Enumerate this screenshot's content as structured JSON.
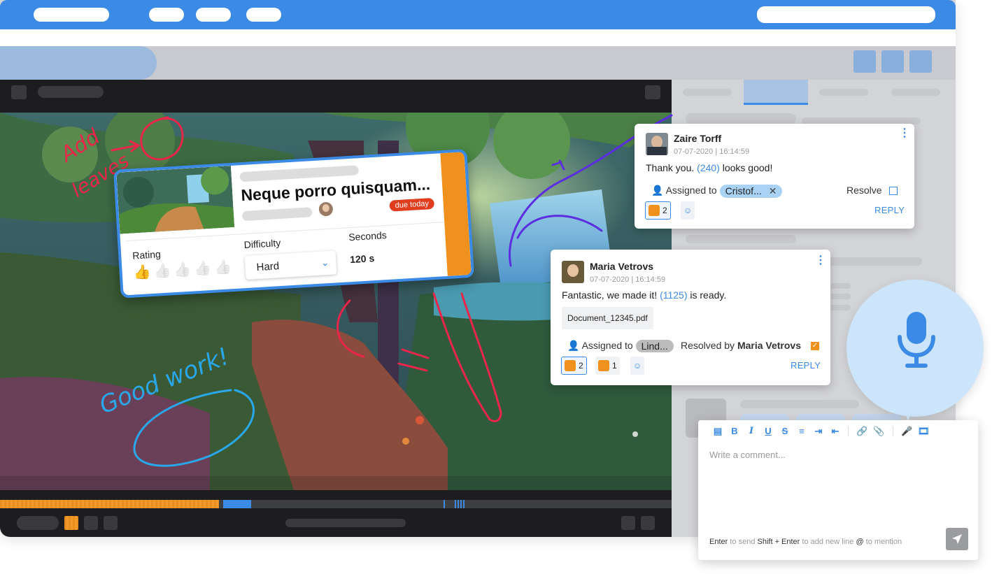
{
  "card": {
    "title": "Neque porro quisquam...",
    "due_badge": "due today",
    "rating_label": "Rating",
    "rating_value": 1,
    "rating_max": 5,
    "difficulty_label": "Difficulty",
    "difficulty_value": "Hard",
    "seconds_label": "Seconds",
    "seconds_value": "120 s"
  },
  "annotations": {
    "add_leaves_line1": "Add",
    "add_leaves_line2": "leaves",
    "good_work": "Good work!"
  },
  "comments": [
    {
      "author": "Zaire Torff",
      "timestamp": "07-07-2020 | 16:14:59",
      "text_before": "Thank you. ",
      "ref": "(240)",
      "text_after": " looks good!",
      "assigned_label": "Assigned to",
      "assignee": "Cristof...",
      "resolve_label": "Resolve",
      "reaction_count": "2",
      "reply": "REPLY"
    },
    {
      "author": "Maria Vetrovs",
      "timestamp": "07-07-2020 | 16:14:59",
      "text_before": "Fantastic, we made it! ",
      "ref": "(1125)",
      "text_after": " is ready.",
      "attachment": "Document_12345.pdf",
      "assigned_label": "Assigned to",
      "assignee": "Lind...",
      "resolved_by_label": "Resolved by",
      "resolved_by": "Maria Vetrovs",
      "reaction1_count": "2",
      "reaction2_count": "1",
      "reply": "REPLY"
    }
  ],
  "editor": {
    "placeholder": "Write a comment...",
    "hint_enter": "Enter",
    "hint_enter_desc": " to send ",
    "hint_shift": "Shift + Enter",
    "hint_shift_desc": " to add new line ",
    "hint_at": "@",
    "hint_at_desc": " to mention"
  },
  "colors": {
    "accent": "#3b8be6",
    "orange": "#f0901d",
    "annotation_red": "#e8264a",
    "annotation_blue": "#2aa7ea",
    "annotation_purple": "#5b2fe0"
  }
}
